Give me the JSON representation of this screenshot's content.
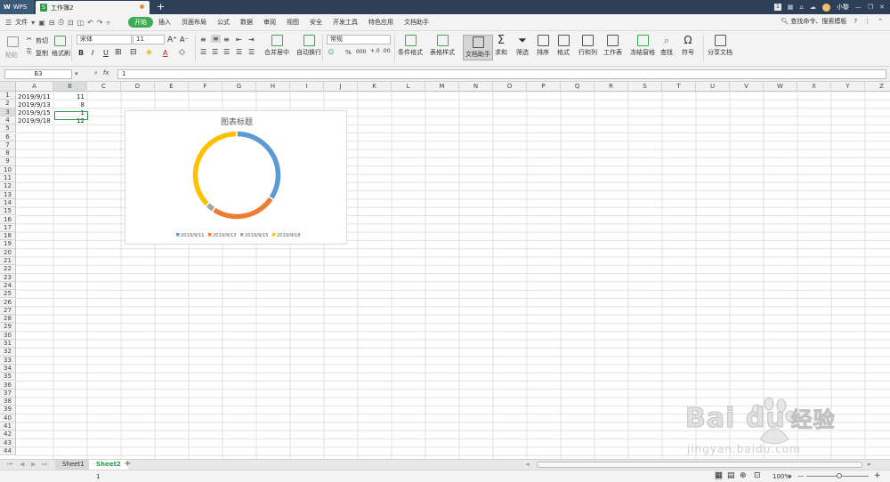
{
  "titlebar": {
    "app_label": "WPS",
    "doc_tab": "工作簿2",
    "new_tab": "+",
    "user_label": "小黎"
  },
  "menubar": {
    "file_label": "文件",
    "tabs": [
      "开始",
      "插入",
      "页面布局",
      "公式",
      "数据",
      "审阅",
      "视图",
      "安全",
      "开发工具",
      "特色应用",
      "文档助手"
    ],
    "search_label": "查找命令、搜索模板",
    "help": "?"
  },
  "toolbar": {
    "paste_label": "粘贴",
    "cut_label": "剪切",
    "copy_label": "复制",
    "format_painter_label": "格式刷",
    "font_name": "宋体",
    "font_size": "11",
    "merge_label": "合并居中",
    "wrap_label": "自动换行",
    "number_format": "常规",
    "percent": "%",
    "thousands": "000",
    "cond_format_label": "条件格式",
    "table_style_label": "表格样式",
    "doc_helper_label": "文档助手",
    "sum_label": "求和",
    "filter_label": "筛选",
    "sort_label": "排序",
    "format_label": "格式",
    "rowcol_label": "行和列",
    "worksheet_label": "工作表",
    "freeze_label": "冻结窗格",
    "find_label": "查找",
    "symbol_label": "符号",
    "share_label": "分享文档"
  },
  "formulabar": {
    "name_box": "B3",
    "fx": "fx",
    "value": "1"
  },
  "columns": [
    "A",
    "B",
    "C",
    "D",
    "E",
    "F",
    "G",
    "H",
    "I",
    "J",
    "K",
    "L",
    "M",
    "N",
    "O",
    "P",
    "Q",
    "R",
    "S",
    "T",
    "U",
    "V",
    "W",
    "X",
    "Y",
    "Z"
  ],
  "rows": [
    "1",
    "2",
    "3",
    "4",
    "5",
    "6",
    "7",
    "8",
    "9",
    "10",
    "11",
    "12",
    "13",
    "14",
    "15",
    "16",
    "17",
    "18",
    "19",
    "20",
    "21",
    "22",
    "23",
    "24",
    "25",
    "26",
    "27",
    "28",
    "29",
    "30",
    "31",
    "32",
    "33",
    "34",
    "35",
    "36",
    "37",
    "38",
    "39",
    "40",
    "41",
    "42",
    "43",
    "44"
  ],
  "cells": [
    {
      "a": "2019/9/11",
      "b": "11"
    },
    {
      "a": "2019/9/13",
      "b": "8"
    },
    {
      "a": "2019/9/15",
      "b": "1"
    },
    {
      "a": "2019/9/18",
      "b": "12"
    }
  ],
  "chart_data": {
    "type": "pie",
    "variant": "doughnut",
    "title": "图表标题",
    "categories": [
      "2019/9/11",
      "2019/9/13",
      "2019/9/15",
      "2019/9/18"
    ],
    "values": [
      11,
      8,
      1,
      12
    ],
    "colors": [
      "#5b9bd5",
      "#ed7d31",
      "#a5a5a5",
      "#ffc000"
    ],
    "legend_position": "bottom"
  },
  "sheets": [
    "Sheet1",
    "Sheet2"
  ],
  "active_sheet": "Sheet2",
  "add_sheet": "+",
  "statusbar": {
    "value": "1",
    "zoom": "100%",
    "zoom_minus": "—",
    "zoom_plus": "+"
  },
  "watermark": {
    "brand": "Bai du",
    "brand_cn": "经验",
    "url": "jingyan.baidu.com"
  }
}
